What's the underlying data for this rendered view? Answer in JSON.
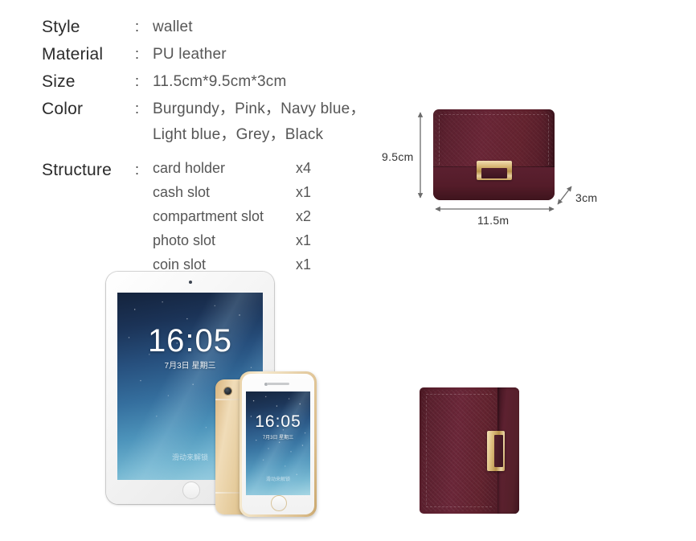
{
  "spec": {
    "rows": [
      {
        "label": "Style",
        "colon": ":",
        "values": [
          "wallet"
        ]
      },
      {
        "label": "Material",
        "colon": ":",
        "values": [
          "PU leather"
        ]
      },
      {
        "label": "Size",
        "colon": ":",
        "values": [
          "11.5cm*9.5cm*3cm"
        ]
      },
      {
        "label": "Color",
        "colon": ":",
        "values": [
          "Burgundy，Pink，Navy blue，",
          "Light blue，Grey，Black"
        ]
      }
    ],
    "structure": {
      "label": "Structure",
      "colon": ":",
      "items": [
        {
          "name": "card holder",
          "qty": "x4"
        },
        {
          "name": "cash slot",
          "qty": "x1"
        },
        {
          "name": "compartment slot",
          "qty": "x2"
        },
        {
          "name": "photo slot",
          "qty": "x1"
        },
        {
          "name": "coin slot",
          "qty": "x1"
        }
      ]
    }
  },
  "dimensions": {
    "height_label": "9.5cm",
    "width_label": "11.5m",
    "depth_label": "3cm",
    "arrow_color": "#6b6b6b"
  },
  "devices": {
    "tablet": {
      "time": "16:05",
      "date": "7月3日 星期三",
      "slide_hint": "滑动来解锁"
    },
    "phone": {
      "time": "16:05",
      "date": "7月3日 星期三",
      "slide_hint": "滑动来解锁"
    }
  },
  "product": {
    "leather_color": "#5d2130",
    "hardware_color": "#d9b978"
  }
}
